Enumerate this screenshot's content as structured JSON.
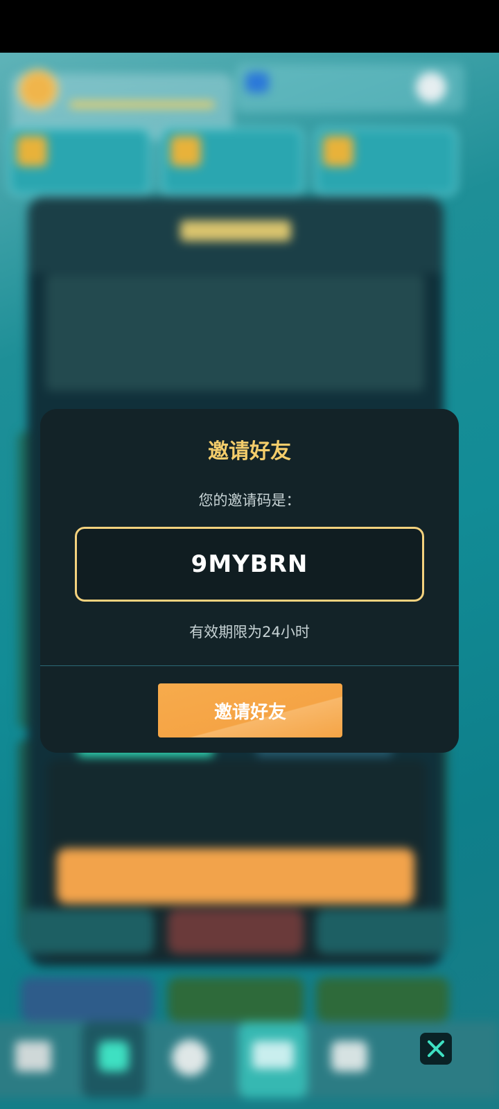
{
  "dialog": {
    "title": "邀请好友",
    "subtitle": "您的邀请码是：",
    "invite_code": "9MYBRN",
    "validity_text": "有效期限为24小时",
    "button_label": "邀请好友",
    "accent_color": "#f4cd6b",
    "button_color": "#f5a445"
  },
  "background": {
    "blurred": true,
    "bottom_nav_icons": [
      "home-icon",
      "shield-icon",
      "gear-icon",
      "diamond-icon",
      "heart-icon"
    ]
  },
  "close_button": {
    "icon": "close-icon",
    "color": "#3ee0c2"
  }
}
